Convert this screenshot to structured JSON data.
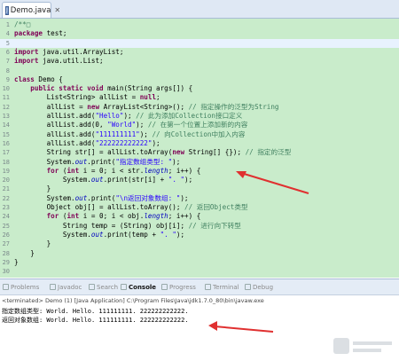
{
  "editor_tab": {
    "label": "Demo.java",
    "close": "✕"
  },
  "code_lines": [
    {
      "n": "1",
      "parts": [
        {
          "c": "cm",
          "t": "/**□"
        }
      ]
    },
    {
      "n": "4",
      "parts": [
        {
          "c": "kw",
          "t": "package"
        },
        {
          "c": "",
          "t": " test;"
        }
      ]
    },
    {
      "n": "5",
      "parts": []
    },
    {
      "n": "6",
      "parts": [
        {
          "c": "kw",
          "t": "import"
        },
        {
          "c": "",
          "t": " java.util.ArrayList;"
        }
      ]
    },
    {
      "n": "7",
      "parts": [
        {
          "c": "kw",
          "t": "import"
        },
        {
          "c": "",
          "t": " java.util.List;"
        }
      ]
    },
    {
      "n": "8",
      "parts": []
    },
    {
      "n": "9",
      "parts": [
        {
          "c": "kw",
          "t": "class"
        },
        {
          "c": "",
          "t": " Demo {"
        }
      ]
    },
    {
      "n": "10",
      "parts": [
        {
          "c": "",
          "t": "    "
        },
        {
          "c": "kw",
          "t": "public static void"
        },
        {
          "c": "",
          "t": " main(String args[]) {"
        }
      ]
    },
    {
      "n": "11",
      "parts": [
        {
          "c": "",
          "t": "        List<String> allList = "
        },
        {
          "c": "kw",
          "t": "null"
        },
        {
          "c": "",
          "t": ";"
        }
      ]
    },
    {
      "n": "12",
      "parts": [
        {
          "c": "",
          "t": "        allList = "
        },
        {
          "c": "kw",
          "t": "new"
        },
        {
          "c": "",
          "t": " ArrayList<String>(); "
        },
        {
          "c": "cm",
          "t": "// 指定操作的泛型为String"
        }
      ]
    },
    {
      "n": "13",
      "parts": [
        {
          "c": "",
          "t": "        allList.add("
        },
        {
          "c": "str",
          "t": "\"Hello\""
        },
        {
          "c": "",
          "t": "); "
        },
        {
          "c": "cm",
          "t": "// 此为添加Collection接口定义"
        }
      ]
    },
    {
      "n": "14",
      "parts": [
        {
          "c": "",
          "t": "        allList.add(0, "
        },
        {
          "c": "str",
          "t": "\"World\""
        },
        {
          "c": "",
          "t": "); "
        },
        {
          "c": "cm",
          "t": "// 在第一个位置上添加新的内容"
        }
      ]
    },
    {
      "n": "15",
      "parts": [
        {
          "c": "",
          "t": "        allList.add("
        },
        {
          "c": "str",
          "t": "\"111111111\""
        },
        {
          "c": "",
          "t": "); "
        },
        {
          "c": "cm",
          "t": "// 向Collection中加入内容"
        }
      ]
    },
    {
      "n": "16",
      "parts": [
        {
          "c": "",
          "t": "        allList.add("
        },
        {
          "c": "str",
          "t": "\"222222222222\""
        },
        {
          "c": "",
          "t": ");"
        }
      ]
    },
    {
      "n": "17",
      "parts": [
        {
          "c": "",
          "t": "        String str[] = allList.toArray("
        },
        {
          "c": "kw",
          "t": "new"
        },
        {
          "c": "",
          "t": " String[] {}); "
        },
        {
          "c": "cm",
          "t": "// 指定的泛型"
        }
      ]
    },
    {
      "n": "18",
      "parts": [
        {
          "c": "",
          "t": "        System."
        },
        {
          "c": "fld",
          "t": "out"
        },
        {
          "c": "",
          "t": ".print("
        },
        {
          "c": "str",
          "t": "\"指定数组类型: \""
        },
        {
          "c": "",
          "t": ");"
        }
      ]
    },
    {
      "n": "19",
      "parts": [
        {
          "c": "",
          "t": "        "
        },
        {
          "c": "kw",
          "t": "for"
        },
        {
          "c": "",
          "t": " ("
        },
        {
          "c": "kw",
          "t": "int"
        },
        {
          "c": "",
          "t": " i = 0; i < str."
        },
        {
          "c": "fld",
          "t": "length"
        },
        {
          "c": "",
          "t": "; i++) {"
        }
      ]
    },
    {
      "n": "20",
      "parts": [
        {
          "c": "",
          "t": "            System."
        },
        {
          "c": "fld",
          "t": "out"
        },
        {
          "c": "",
          "t": ".print(str[i] + "
        },
        {
          "c": "str",
          "t": "\". \""
        },
        {
          "c": "",
          "t": ");"
        }
      ]
    },
    {
      "n": "21",
      "parts": [
        {
          "c": "",
          "t": "        }"
        }
      ]
    },
    {
      "n": "22",
      "parts": [
        {
          "c": "",
          "t": "        System."
        },
        {
          "c": "fld",
          "t": "out"
        },
        {
          "c": "",
          "t": ".print("
        },
        {
          "c": "str",
          "t": "\"\\n返回对象数组: \""
        },
        {
          "c": "",
          "t": ");"
        }
      ]
    },
    {
      "n": "23",
      "parts": [
        {
          "c": "",
          "t": "        Object obj[] = allList.toArray(); "
        },
        {
          "c": "cm",
          "t": "// 返回Object类型"
        }
      ]
    },
    {
      "n": "24",
      "parts": [
        {
          "c": "",
          "t": "        "
        },
        {
          "c": "kw",
          "t": "for"
        },
        {
          "c": "",
          "t": " ("
        },
        {
          "c": "kw",
          "t": "int"
        },
        {
          "c": "",
          "t": " i = 0; i < obj."
        },
        {
          "c": "fld",
          "t": "length"
        },
        {
          "c": "",
          "t": "; i++) {"
        }
      ]
    },
    {
      "n": "25",
      "parts": [
        {
          "c": "",
          "t": "            String temp = (String) obj[i]; "
        },
        {
          "c": "cm",
          "t": "// 进行向下转型"
        }
      ]
    },
    {
      "n": "26",
      "parts": [
        {
          "c": "",
          "t": "            System."
        },
        {
          "c": "fld",
          "t": "out"
        },
        {
          "c": "",
          "t": ".print(temp + "
        },
        {
          "c": "str",
          "t": "\". \""
        },
        {
          "c": "",
          "t": ");"
        }
      ]
    },
    {
      "n": "27",
      "parts": [
        {
          "c": "",
          "t": "        }"
        }
      ]
    },
    {
      "n": "28",
      "parts": [
        {
          "c": "",
          "t": "    }"
        }
      ]
    },
    {
      "n": "29",
      "parts": [
        {
          "c": "",
          "t": "}"
        }
      ]
    },
    {
      "n": "30",
      "parts": []
    }
  ],
  "views_tabs": [
    {
      "label": "Problems",
      "active": false
    },
    {
      "label": "Javadoc",
      "active": false
    },
    {
      "label": "Search",
      "active": false
    },
    {
      "label": "Console",
      "active": true
    },
    {
      "label": "Progress",
      "active": false
    },
    {
      "label": "Terminal",
      "active": false
    },
    {
      "label": "Debug",
      "active": false
    }
  ],
  "console": {
    "terminated": "<terminated> Demo (1) [Java Application] C:\\Program Files\\Java\\jdk1.7.0_80\\bin\\javaw.exe",
    "line1": "指定数组类型: World. Hello. 111111111. 222222222222.",
    "line2": "返回对象数组: World. Hello. 111111111. 222222222222."
  },
  "colors": {
    "editor_bg": "#c9eccb",
    "keyword": "#7f0055",
    "string": "#2a00ff",
    "comment": "#3f7f5f",
    "arrow": "#e03030"
  }
}
